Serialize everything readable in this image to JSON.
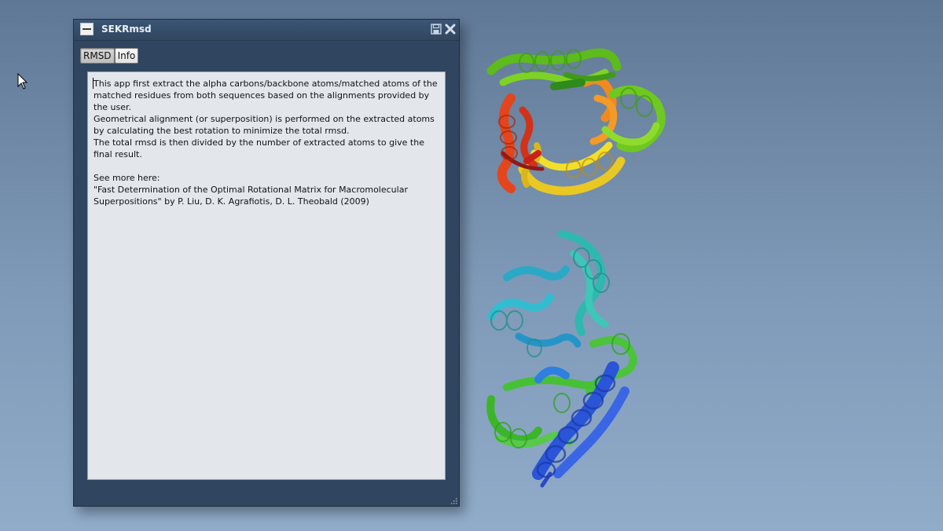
{
  "window": {
    "title": "SEKRmsd"
  },
  "tabs": [
    {
      "label": "RMSD",
      "active": true
    },
    {
      "label": "Info",
      "active": false
    }
  ],
  "info": {
    "text": "This app first extract the alpha carbons/backbone atoms/matched atoms of the matched residues from both sequences based on the alignments provided by the user.\nGeometrical alignment (or superposition) is performed on the extracted atoms by calculating the best rotation to minimize the total rmsd.\nThe total rmsd is then divided by the number of extracted atoms to give the final result.\n\nSee more here:\n\"Fast Determination of the Optimal Rotational Matrix for Macromolecular Superpositions\" by P. Liu, D. K. Agrafiotis, D. L. Theobald (2009)"
  },
  "colors": {
    "desktop_top": "#5f7896",
    "desktop_bottom": "#90acc9",
    "window_body": "#2f4560",
    "panel_bg": "#e3e7ec"
  },
  "icons": {
    "app_logo": "app-logo-icon",
    "save": "save-icon",
    "close": "close-icon",
    "cursor": "mouse-cursor-icon",
    "resize": "resize-grip-icon"
  }
}
